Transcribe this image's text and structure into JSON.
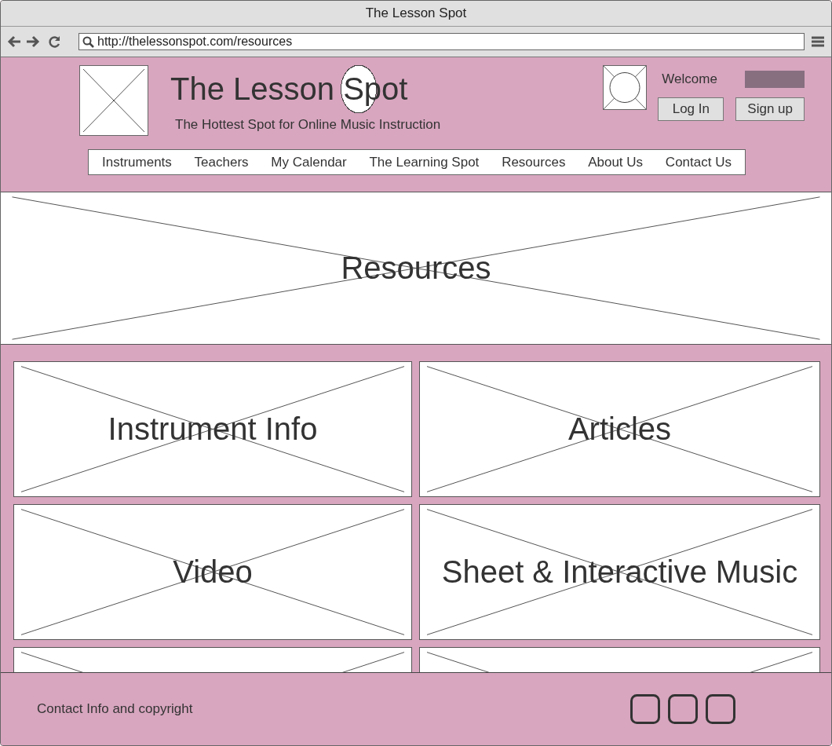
{
  "window": {
    "title": "The Lesson Spot"
  },
  "browser": {
    "url": "http://thelessonspot.com/resources"
  },
  "header": {
    "site_title": "The Lesson Spot",
    "tagline": "The Hottest Spot for Online Music Instruction",
    "welcome": "Welcome",
    "buttons": [
      "Log In",
      "Sign up"
    ]
  },
  "nav": [
    {
      "label": "Instruments"
    },
    {
      "label": "Teachers"
    },
    {
      "label": "My Calendar"
    },
    {
      "label": "The Learning Spot"
    },
    {
      "label": "Resources"
    },
    {
      "label": "About Us"
    },
    {
      "label": "Contact Us"
    }
  ],
  "hero": {
    "label": "Resources"
  },
  "tiles": [
    {
      "kind": "tile",
      "label": "Instrument Info"
    },
    {
      "kind": "tile",
      "label": "Articles"
    },
    {
      "kind": "tile",
      "label": "Video"
    },
    {
      "kind": "tile",
      "label": "Sheet & Interactive Music"
    },
    {
      "kind": "placeholder"
    },
    {
      "kind": "placeholder"
    }
  ],
  "footer": {
    "text": "Contact Info and copyright"
  }
}
